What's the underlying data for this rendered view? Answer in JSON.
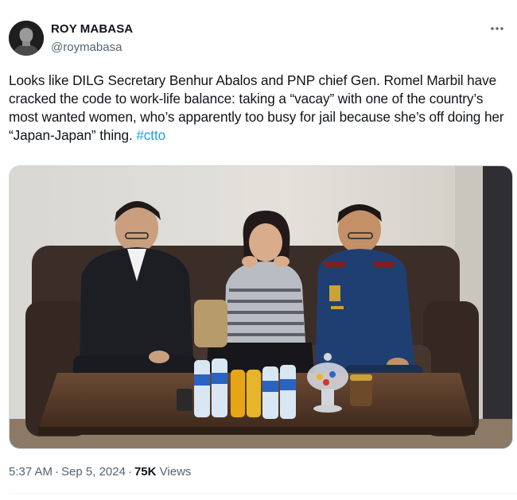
{
  "author": {
    "display_name": "ROY MABASA",
    "handle": "@roymabasa"
  },
  "tweet": {
    "text": "Looks like DILG Secretary Benhur Abalos and PNP chief Gen. Romel Marbil have cracked the code to work-life balance: taking a “vacay” with one of the country’s most wanted women, who’s apparently too busy for jail because she’s off doing her “Japan-Japan” thing.",
    "hashtag": "#ctto"
  },
  "meta": {
    "time": "5:37 AM",
    "date": "Sep 5, 2024",
    "views_count": "75K",
    "views_label": "Views"
  },
  "icons": {
    "more": "more-horizontal-icon"
  },
  "colors": {
    "link": "#1d9bf0",
    "secondary_text": "#536471",
    "primary_text": "#0f1419",
    "border": "#cfd9de"
  }
}
